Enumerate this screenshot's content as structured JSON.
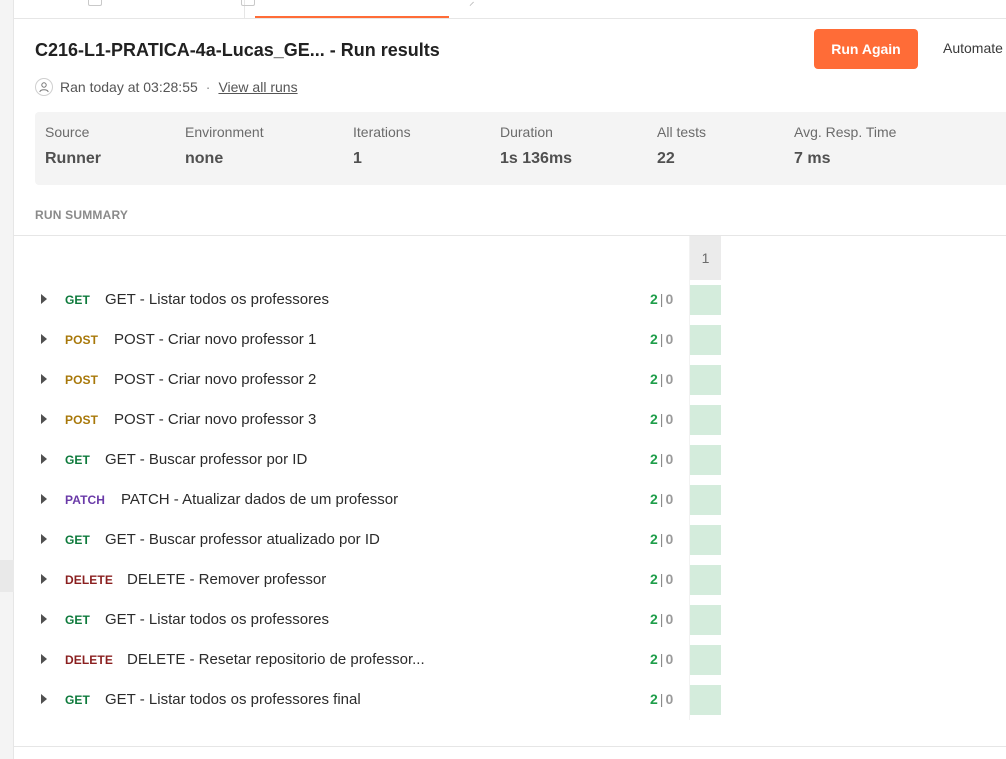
{
  "header": {
    "title": "C216-L1-PRATICA-4a-Lucas_GE... - Run results",
    "run_again_label": "Run Again",
    "automate_label": "Automate",
    "ran_text": "Ran today at 03:28:55",
    "separator": "·",
    "view_all_label": "View all runs"
  },
  "stats": [
    {
      "label": "Source",
      "value": "Runner"
    },
    {
      "label": "Environment",
      "value": "none"
    },
    {
      "label": "Iterations",
      "value": "1"
    },
    {
      "label": "Duration",
      "value": "1s 136ms"
    },
    {
      "label": "All tests",
      "value": "22"
    },
    {
      "label": "Avg. Resp. Time",
      "value": "7 ms"
    }
  ],
  "summary": {
    "heading": "RUN SUMMARY",
    "iteration_header": "1",
    "bar": "|",
    "requests": [
      {
        "method": "GET",
        "name": "GET - Listar todos os professores",
        "passed": "2",
        "failed": "0"
      },
      {
        "method": "POST",
        "name": "POST - Criar novo professor 1",
        "passed": "2",
        "failed": "0"
      },
      {
        "method": "POST",
        "name": "POST - Criar novo professor 2",
        "passed": "2",
        "failed": "0"
      },
      {
        "method": "POST",
        "name": "POST - Criar novo professor 3",
        "passed": "2",
        "failed": "0"
      },
      {
        "method": "GET",
        "name": "GET - Buscar professor por ID",
        "passed": "2",
        "failed": "0"
      },
      {
        "method": "PATCH",
        "name": "PATCH - Atualizar dados de um professor",
        "passed": "2",
        "failed": "0"
      },
      {
        "method": "GET",
        "name": "GET - Buscar professor atualizado por ID",
        "passed": "2",
        "failed": "0"
      },
      {
        "method": "DELETE",
        "name": "DELETE - Remover professor",
        "passed": "2",
        "failed": "0"
      },
      {
        "method": "GET",
        "name": "GET - Listar todos os professores",
        "passed": "2",
        "failed": "0"
      },
      {
        "method": "DELETE",
        "name": "DELETE - Resetar repositorio de professor...",
        "passed": "2",
        "failed": "0"
      },
      {
        "method": "GET",
        "name": "GET - Listar todos os professores final",
        "passed": "2",
        "failed": "0"
      }
    ]
  },
  "colors": {
    "accent": "#ff6c37",
    "pass": "#1f9e4a",
    "pass_cell": "#d4ecdc",
    "get": "#0e7a3c",
    "post": "#a8780a",
    "patch": "#6a3aa8",
    "delete": "#8a1f1f"
  },
  "icons": {
    "user": "user-icon",
    "expand": "caret-right-icon"
  }
}
